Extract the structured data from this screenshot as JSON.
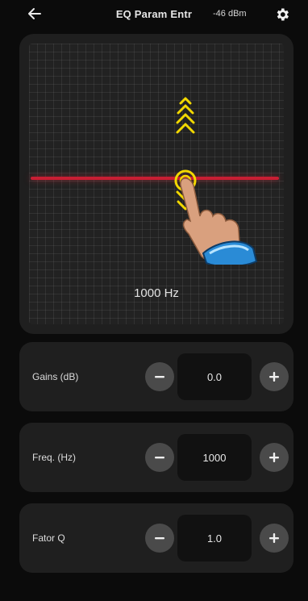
{
  "header": {
    "title": "EQ Param Entr",
    "signal": "-46 dBm",
    "back_icon": "arrow-left-icon",
    "settings_icon": "gear-icon"
  },
  "graph": {
    "frequency_label": "1000 Hz",
    "line_color": "#c81e33",
    "gesture_hint": "swipe-up-down"
  },
  "params": [
    {
      "label": "Gains (dB)",
      "value": "0.0",
      "minus_icon": "minus-icon",
      "plus_icon": "plus-icon"
    },
    {
      "label": "Freq. (Hz)",
      "value": "1000",
      "minus_icon": "minus-icon",
      "plus_icon": "plus-icon"
    },
    {
      "label": "Fator Q",
      "value": "1.0",
      "minus_icon": "minus-icon",
      "plus_icon": "plus-icon"
    }
  ]
}
